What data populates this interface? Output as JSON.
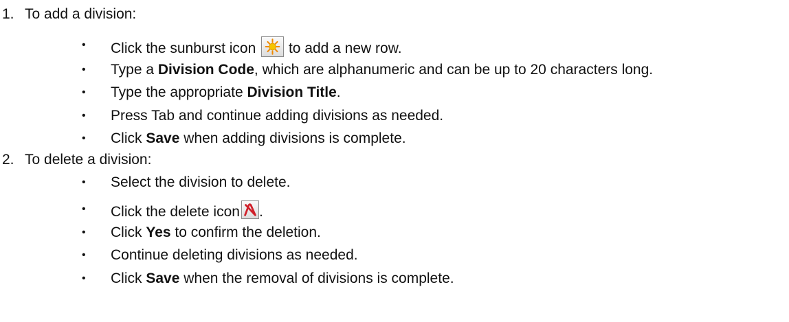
{
  "steps": [
    {
      "number": "1.",
      "title": "To add a division:",
      "bullets": [
        {
          "bullet": "•",
          "before": "Click the sunburst icon",
          "icon": "sunburst-icon",
          "after": "to add a new row."
        },
        {
          "bullet": "•",
          "before": "Type a",
          "bold": "Division Code",
          "after": ", which are alphanumeric and can be up to 20 characters long."
        },
        {
          "bullet": "•",
          "before": "Type the appropriate",
          "bold": "Division Title",
          "after": "."
        },
        {
          "bullet": "•",
          "text": "Press Tab and continue adding divisions as needed."
        },
        {
          "bullet": "•",
          "before": "Click",
          "bold": "Save",
          "after": "when adding divisions is complete."
        }
      ]
    },
    {
      "number": "2.",
      "title": "To delete a division:",
      "bullets": [
        {
          "bullet": "•",
          "text": "Select the division to delete."
        },
        {
          "bullet": "•",
          "before": "Click the delete icon",
          "icon": "delete-icon",
          "after": "."
        },
        {
          "bullet": "•",
          "before": "Click",
          "bold": "Yes",
          "after": "to confirm the deletion."
        },
        {
          "bullet": "•",
          "text": "Continue deleting divisions as needed."
        },
        {
          "bullet": "•",
          "before": "Click",
          "bold": "Save",
          "after": "when the removal of divisions is complete."
        }
      ]
    }
  ],
  "colors": {
    "text": "#111111",
    "sun_core": "#f5c400",
    "sun_rays": "#f08a00",
    "delete_red": "#d0202a"
  }
}
